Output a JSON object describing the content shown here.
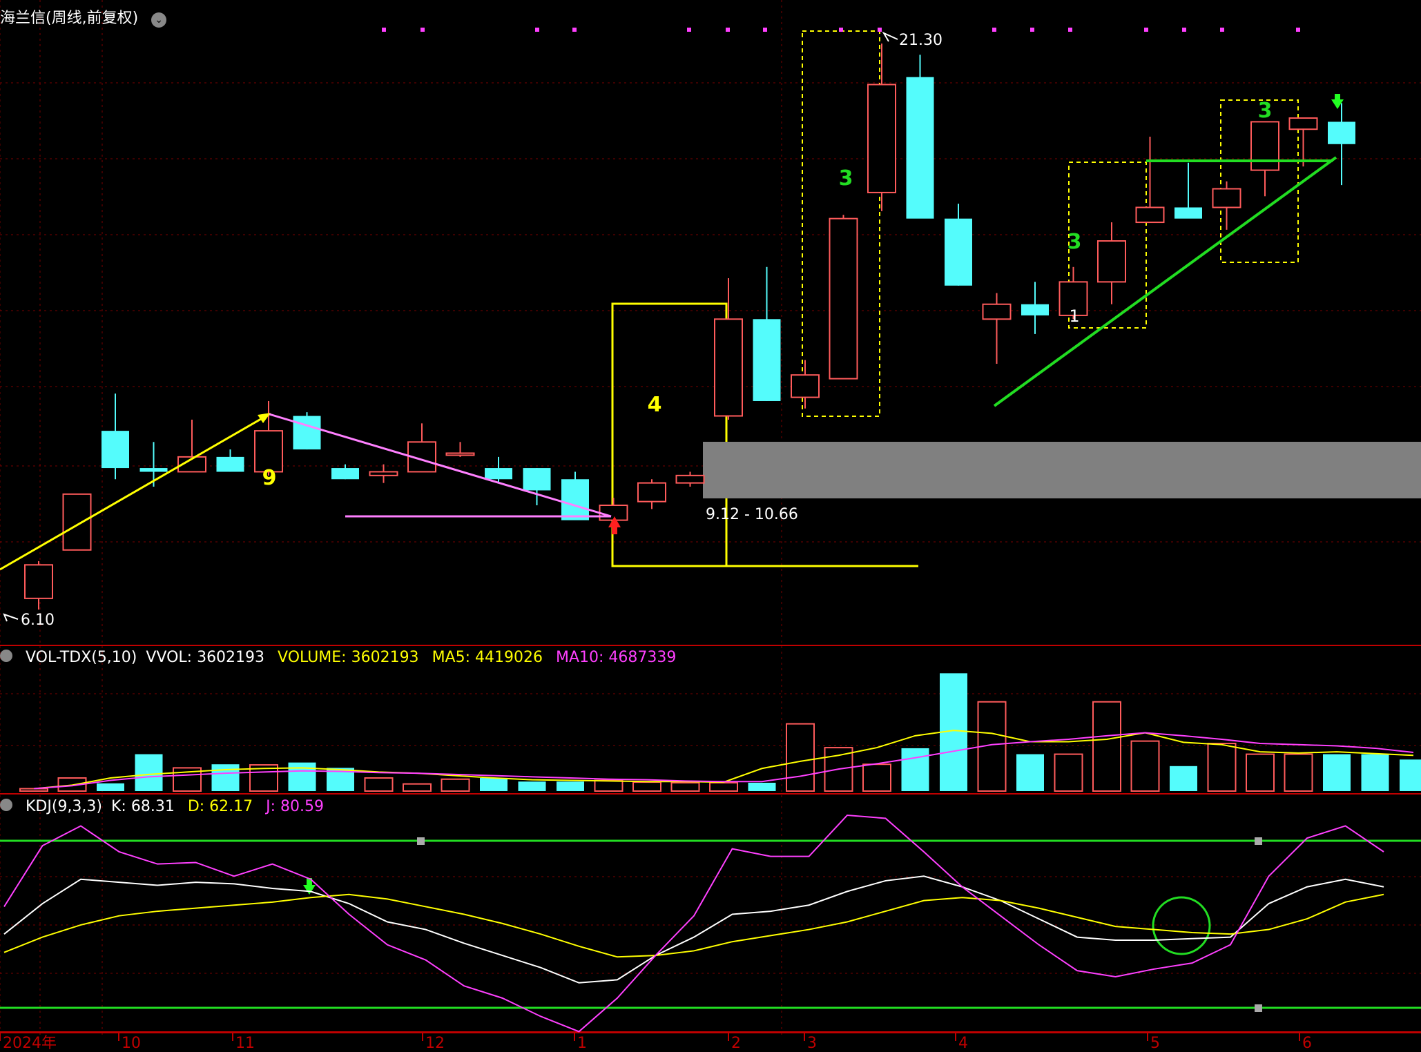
{
  "title": "海兰信(周线,前复权)",
  "colors": {
    "up": "#ff5b5b",
    "down": "#54fcfc",
    "grid": "#7a0000",
    "yellow": "#ffff00",
    "magenta": "#ff40ff",
    "green": "#00ff00",
    "white": "#ffffff"
  },
  "chart_data": [
    {
      "type": "candlestick",
      "title": "海兰信(周线,前复权)",
      "ohlc": [
        {
          "o": 6.4,
          "h": 7.4,
          "l": 6.1,
          "c": 7.3
        },
        {
          "o": 7.7,
          "h": 9.2,
          "l": 7.7,
          "c": 9.2
        },
        {
          "o": 10.9,
          "h": 11.9,
          "l": 9.6,
          "c": 9.9
        },
        {
          "o": 9.9,
          "h": 10.6,
          "l": 9.4,
          "c": 9.8
        },
        {
          "o": 9.8,
          "h": 11.2,
          "l": 9.8,
          "c": 10.2
        },
        {
          "o": 10.2,
          "h": 10.4,
          "l": 9.8,
          "c": 9.8
        },
        {
          "o": 9.8,
          "h": 11.7,
          "l": 9.7,
          "c": 10.9
        },
        {
          "o": 11.3,
          "h": 11.4,
          "l": 10.4,
          "c": 10.4
        },
        {
          "o": 9.9,
          "h": 10.0,
          "l": 9.6,
          "c": 9.6
        },
        {
          "o": 9.7,
          "h": 10.0,
          "l": 9.5,
          "c": 9.8
        },
        {
          "o": 9.8,
          "h": 11.1,
          "l": 9.8,
          "c": 10.6
        },
        {
          "o": 10.3,
          "h": 10.6,
          "l": 10.2,
          "c": 10.3
        },
        {
          "o": 9.9,
          "h": 10.2,
          "l": 9.5,
          "c": 9.6
        },
        {
          "o": 9.9,
          "h": 9.9,
          "l": 8.9,
          "c": 9.3
        },
        {
          "o": 9.6,
          "h": 9.8,
          "l": 8.6,
          "c": 8.5
        },
        {
          "o": 8.5,
          "h": 9.1,
          "l": 8.5,
          "c": 8.9
        },
        {
          "o": 9.0,
          "h": 9.6,
          "l": 8.8,
          "c": 9.5
        },
        {
          "o": 9.5,
          "h": 9.8,
          "l": 9.4,
          "c": 9.7
        },
        {
          "o": 11.3,
          "h": 15.0,
          "l": 11.2,
          "c": 13.9
        },
        {
          "o": 13.9,
          "h": 15.3,
          "l": 11.7,
          "c": 11.7
        },
        {
          "o": 11.8,
          "h": 12.8,
          "l": 11.5,
          "c": 12.4
        },
        {
          "o": 12.3,
          "h": 16.7,
          "l": 12.3,
          "c": 16.6
        },
        {
          "o": 17.3,
          "h": 21.3,
          "l": 16.8,
          "c": 20.2
        },
        {
          "o": 20.4,
          "h": 21.0,
          "l": 16.7,
          "c": 16.6
        },
        {
          "o": 16.6,
          "h": 17.0,
          "l": 14.8,
          "c": 14.8
        },
        {
          "o": 13.9,
          "h": 14.6,
          "l": 12.7,
          "c": 14.3
        },
        {
          "o": 14.3,
          "h": 14.9,
          "l": 13.5,
          "c": 14.0
        },
        {
          "o": 14.0,
          "h": 15.3,
          "l": 13.9,
          "c": 14.9
        },
        {
          "o": 14.9,
          "h": 16.5,
          "l": 14.3,
          "c": 16.0
        },
        {
          "o": 16.5,
          "h": 18.8,
          "l": 16.5,
          "c": 16.9
        },
        {
          "o": 16.9,
          "h": 18.1,
          "l": 16.7,
          "c": 16.6
        },
        {
          "o": 16.9,
          "h": 17.6,
          "l": 16.3,
          "c": 17.4
        },
        {
          "o": 17.9,
          "h": 19.1,
          "l": 17.2,
          "c": 19.2
        },
        {
          "o": 19.0,
          "h": 19.3,
          "l": 18.0,
          "c": 19.3
        },
        {
          "o": 19.2,
          "h": 19.7,
          "l": 17.5,
          "c": 18.6
        }
      ],
      "annotations": {
        "high_label": "21.30",
        "low_label": "6.10",
        "zone_label": "9.12 - 10.66",
        "count_labels": [
          "9",
          "4",
          "3",
          "3",
          "3",
          "1"
        ]
      },
      "ylim": [
        5.6,
        22.1
      ]
    },
    {
      "type": "bar",
      "title": "VOL-TDX(5,10)",
      "header_text": {
        "vvol": "VVOL: 3602193",
        "volume": "VOLUME: 3602193",
        "ma5": "MA5: 4419026",
        "ma10": "MA10: 4687339"
      },
      "values": [
        0.4,
        2.2,
        1.3,
        6.2,
        3.9,
        4.5,
        4.4,
        4.8,
        3.9,
        2.2,
        1.2,
        2.0,
        2.2,
        1.6,
        1.6,
        1.8,
        1.5,
        1.4,
        1.4,
        1.4,
        11.3,
        7.3,
        4.5,
        7.2,
        19.8,
        15.0,
        6.2,
        6.2,
        15.0,
        8.4,
        4.2,
        8.0,
        6.2,
        6.2,
        6.2,
        6.2,
        5.3
      ],
      "series": [
        {
          "name": "MA5",
          "values": [
            0.4,
            1.0,
            2.2,
            2.8,
            3.2,
            3.6,
            3.8,
            3.9,
            3.6,
            3.2,
            3.0,
            2.6,
            2.2,
            1.9,
            1.8,
            1.7,
            1.6,
            1.6,
            1.5,
            3.8,
            5.0,
            6.0,
            7.3,
            9.3,
            10.2,
            9.7,
            8.3,
            8.3,
            8.7,
            9.8,
            8.2,
            7.8,
            6.6,
            6.4,
            6.6,
            6.3,
            6.0
          ]
        },
        {
          "name": "MA10",
          "values": [
            0.4,
            0.9,
            1.8,
            2.4,
            2.7,
            3.0,
            3.2,
            3.4,
            3.3,
            3.1,
            3.0,
            2.8,
            2.6,
            2.4,
            2.2,
            2.0,
            1.9,
            1.7,
            1.6,
            1.6,
            2.5,
            3.7,
            4.6,
            5.6,
            6.7,
            7.8,
            8.3,
            8.7,
            9.3,
            9.8,
            9.3,
            8.7,
            8.0,
            7.8,
            7.6,
            7.2,
            6.5
          ]
        }
      ],
      "ylim": [
        0,
        21
      ]
    },
    {
      "type": "line",
      "title": "KDJ(9,3,3)",
      "header_text": {
        "k": "K: 68.31",
        "d": "D: 62.17",
        "j": "J: 80.59"
      },
      "x_ticks": [
        "2024年",
        "10",
        "11",
        "12",
        "1",
        "2",
        "3",
        "4",
        "5",
        "6"
      ],
      "series": [
        {
          "name": "K",
          "values": [
            32,
            52,
            68,
            66,
            64,
            66,
            65,
            62,
            60,
            52,
            40,
            35,
            26,
            18,
            10,
            0,
            2,
            18,
            30,
            45,
            47,
            51,
            60,
            67,
            70,
            63,
            54,
            42,
            30,
            28,
            28,
            29,
            30,
            52,
            63,
            68,
            63
          ]
        },
        {
          "name": "D",
          "values": [
            20,
            30,
            38,
            44,
            47,
            49,
            51,
            53,
            56,
            58,
            55,
            50,
            45,
            39,
            32,
            24,
            17,
            18,
            21,
            27,
            31,
            35,
            40,
            47,
            54,
            56,
            54,
            49,
            43,
            37,
            35,
            33,
            32,
            35,
            42,
            53,
            58
          ]
        },
        {
          "name": "J",
          "values": [
            50,
            90,
            103,
            86,
            78,
            79,
            70,
            78,
            68,
            45,
            25,
            15,
            -2,
            -10,
            -22,
            -32,
            -10,
            18,
            44,
            88,
            83,
            83,
            110,
            108,
            86,
            63,
            44,
            25,
            8,
            4,
            9,
            13,
            25,
            70,
            95,
            103,
            86
          ]
        }
      ],
      "ylim": [
        -30,
        115
      ]
    }
  ]
}
